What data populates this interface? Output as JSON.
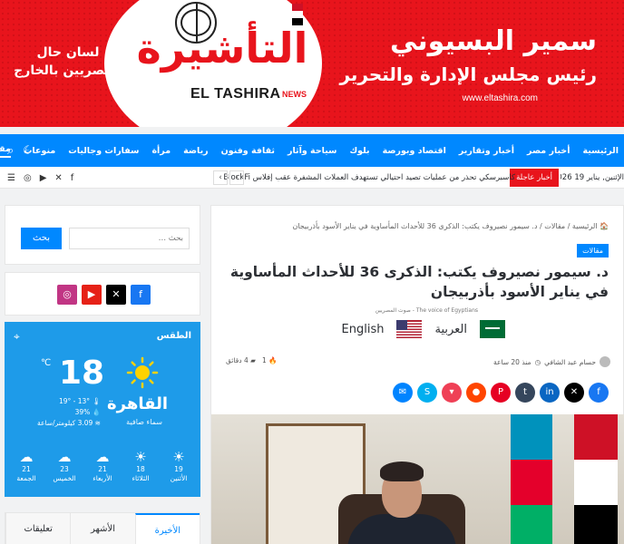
{
  "banner": {
    "brand_ar": "التأشيرة",
    "brand_en": "EL TASHIRA",
    "brand_news": "NEWS",
    "tagline_1": "لسان حال",
    "tagline_2": "المصريين بالخارج",
    "person_name": "سمير البسيوني",
    "person_role": "رئيس مجلس الإدارة والتحرير",
    "website": "www.eltashira.com"
  },
  "nav": {
    "items": [
      "الرئيسية",
      "أخبار مصر",
      "أخبار وتقارير",
      "اقتصاد وبورصة",
      "بلوك",
      "سياحة وآثار",
      "ثقافة وفنون",
      "رياضة",
      "مرأة",
      "سفارات وجاليات",
      "منوعات",
      "مقالات"
    ],
    "active_index": 11
  },
  "ticker": {
    "badge": "أخبار عاجلة",
    "headline": "كاسبرسكي تحذر من عمليات تصيد احتيالي تستهدف العملات المشفرة عقب إفلاس BlockFi",
    "date": "الإثنين, يناير 19 2026"
  },
  "sidebar": {
    "search_button": "بحث",
    "search_placeholder": "بحث …"
  },
  "weather": {
    "title": "الطقس",
    "city": "القاهرة",
    "description": "سماء صافية",
    "temperature": "18",
    "unit": "℃",
    "range": "13° - 19°",
    "humidity": "39%",
    "wind": "3.09 كيلومتر/ساعة",
    "days": [
      {
        "temp": "19",
        "name": "الأثنين",
        "icon": "☀"
      },
      {
        "temp": "18",
        "name": "الثلاثاء",
        "icon": "☀"
      },
      {
        "temp": "21",
        "name": "الأربعاء",
        "icon": "☁"
      },
      {
        "temp": "23",
        "name": "الخميس",
        "icon": "☁"
      },
      {
        "temp": "21",
        "name": "الجمعة",
        "icon": "☁"
      }
    ]
  },
  "tabs": [
    "الأخيرة",
    "الأشهر",
    "تعليقات"
  ],
  "article": {
    "breadcrumb": "الرئيسية / مقالات / د. سيمور نصيروف يكتب: الذكرى 36 للأحداث المأساوية في يناير الأسود بأذربيجان",
    "category": "مقالات",
    "title": "د. سيمور نصيروف يكتب: الذكرى 36 للأحداث المأساوية في يناير الأسود بأذربيجان",
    "voice": "صوت المصريين - The voice of Egyptians",
    "lang_ar": "العربية",
    "lang_en": "English",
    "author": "حسام عبد الشافي",
    "time": "منذ 20 ساعة",
    "read_time": "4 دقائق",
    "views": "1"
  },
  "colors": {
    "brand_red": "#e8141c",
    "nav_blue": "#0088ff",
    "weather_blue": "#1e9be9"
  }
}
